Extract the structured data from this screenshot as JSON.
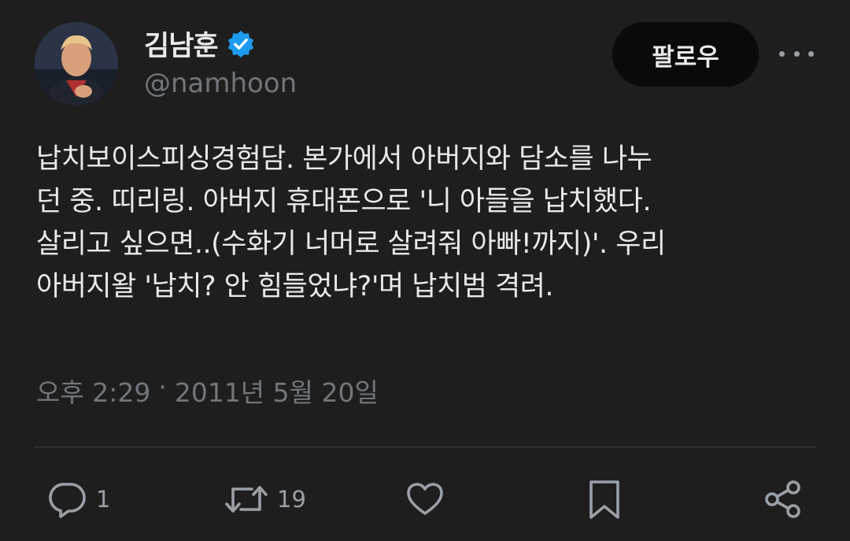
{
  "user": {
    "display_name": "김남훈",
    "handle": "@namhoon",
    "verified_icon": "verified-badge-icon",
    "avatar_icon": "profile-photo"
  },
  "follow_button": {
    "label": "팔로우"
  },
  "more_button": {
    "icon": "more-horizontal-icon"
  },
  "tweet": {
    "text": "납치보이스피싱경험담. 본가에서 아버지와 담소를 나누\n던 중. 띠리링. 아버지 휴대폰으로 '니 아들을 납치했다.\n살리고 싶으면..(수화기 너머로 살려줘 아빠!까지)'. 우리\n아버지왈 '납치? 안 힘들었냐?'며 납치범 격려.",
    "time": "오후 2:29",
    "separator": "·",
    "date": "2011년 5월 20일"
  },
  "actions": {
    "reply": {
      "icon": "reply-icon",
      "count": "1"
    },
    "retweet": {
      "icon": "retweet-icon",
      "count": "19"
    },
    "like": {
      "icon": "heart-icon"
    },
    "bookmark": {
      "icon": "bookmark-icon"
    },
    "share": {
      "icon": "share-icon"
    }
  },
  "colors": {
    "background": "#1e1e1e",
    "text": "#e7e9ea",
    "secondary": "#71767b",
    "verified": "#1d9bf0"
  }
}
